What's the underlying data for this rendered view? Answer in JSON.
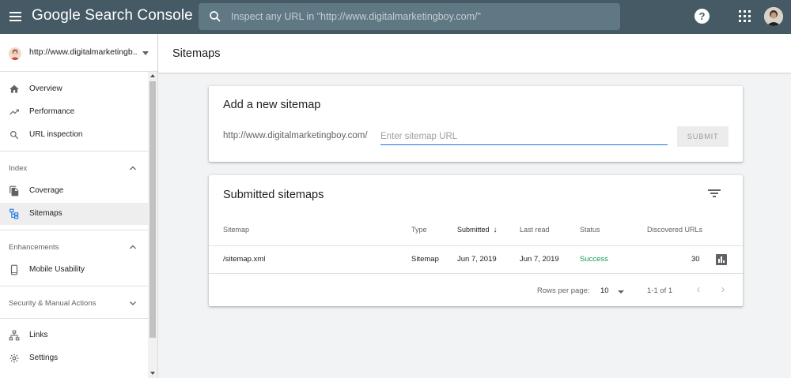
{
  "topbar": {
    "brand": "Google Search Console",
    "search_placeholder": "Inspect any URL in \"http://www.digitalmarketingboy.com/\"",
    "help_label": "?"
  },
  "sidebar": {
    "property": "http://www.digitalmarketingb...",
    "items_top": [
      {
        "label": "Overview",
        "icon": "home-icon"
      },
      {
        "label": "Performance",
        "icon": "trending-up-icon"
      },
      {
        "label": "URL inspection",
        "icon": "search-icon"
      }
    ],
    "index": {
      "header": "Index",
      "items": [
        {
          "label": "Coverage",
          "icon": "file-copy-icon"
        },
        {
          "label": "Sitemaps",
          "icon": "sitemap-icon"
        }
      ]
    },
    "enhancements": {
      "header": "Enhancements",
      "items": [
        {
          "label": "Mobile Usability",
          "icon": "smartphone-icon"
        }
      ]
    },
    "security": {
      "header": "Security & Manual Actions"
    },
    "items_bottom": [
      {
        "label": "Links",
        "icon": "links-icon"
      },
      {
        "label": "Settings",
        "icon": "gear-icon"
      }
    ]
  },
  "page": {
    "title": "Sitemaps"
  },
  "add_sitemap": {
    "title": "Add a new sitemap",
    "prefix": "http://www.digitalmarketingboy.com/",
    "placeholder": "Enter sitemap URL",
    "submit_label": "SUBMIT"
  },
  "submitted": {
    "title": "Submitted sitemaps",
    "columns": {
      "sitemap": "Sitemap",
      "type": "Type",
      "submitted": "Submitted",
      "last_read": "Last read",
      "status": "Status",
      "discovered": "Discovered URLs"
    },
    "rows": [
      {
        "sitemap": "/sitemap.xml",
        "type": "Sitemap",
        "submitted": "Jun 7, 2019",
        "last_read": "Jun 7, 2019",
        "status": "Success",
        "discovered": "30"
      }
    ],
    "pager": {
      "rows_per_page_label": "Rows per page:",
      "rows_per_page_value": "10",
      "range": "1-1 of 1"
    }
  },
  "colors": {
    "topbar": "#455a64",
    "accent": "#1a73e8",
    "success": "#0f9d58"
  }
}
